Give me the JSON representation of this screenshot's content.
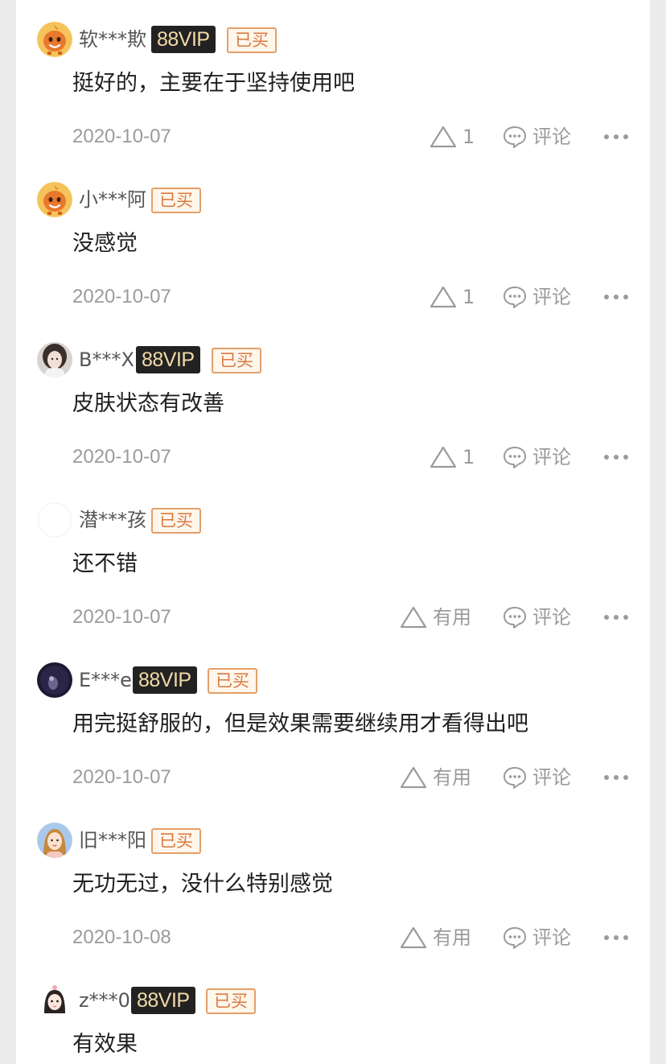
{
  "colors": {
    "page_bg": "#ececec",
    "card_bg": "#ffffff",
    "vip_bg": "#222222",
    "vip_text": "#f3d9a8",
    "bought_border": "#e3a06a",
    "bought_text": "#d9783e",
    "meta_text": "#9b9b9b"
  },
  "reviews": [
    {
      "avatar_icon": "orange-mascot-avatar",
      "username": "软***欺",
      "vip": "88VIP",
      "bought": "已买",
      "content": "挺好的，主要在于坚持使用吧",
      "date": "2020-10-07",
      "useful": "1",
      "comment": "评论"
    },
    {
      "avatar_icon": "orange-mascot-avatar",
      "username": "小***阿",
      "vip": "",
      "bought": "已买",
      "content": "没感觉",
      "date": "2020-10-07",
      "useful": "1",
      "comment": "评论"
    },
    {
      "avatar_icon": "photo-avatar",
      "username": "B***X",
      "vip": "88VIP",
      "bought": "已买",
      "content": "皮肤状态有改善",
      "date": "2020-10-07",
      "useful": "1",
      "comment": "评论"
    },
    {
      "avatar_icon": "blank-avatar",
      "username": "潜***孩",
      "vip": "",
      "bought": "已买",
      "content": "还不错",
      "date": "2020-10-07",
      "useful": "有用",
      "comment": "评论"
    },
    {
      "avatar_icon": "dark-photo-avatar",
      "username": "E***e",
      "vip": "88VIP",
      "bought": "已买",
      "content": "用完挺舒服的，但是效果需要继续用才看得出吧",
      "date": "2020-10-07",
      "useful": "有用",
      "comment": "评论"
    },
    {
      "avatar_icon": "cartoon-girl-avatar",
      "username": "旧***阳",
      "vip": "",
      "bought": "已买",
      "content": "无功无过，没什么特别感觉",
      "date": "2020-10-08",
      "useful": "有用",
      "comment": "评论"
    },
    {
      "avatar_icon": "doll-avatar",
      "username": "z***0",
      "vip": "88VIP",
      "bought": "已买",
      "content": "有效果",
      "date": "",
      "useful": "",
      "comment": ""
    }
  ]
}
